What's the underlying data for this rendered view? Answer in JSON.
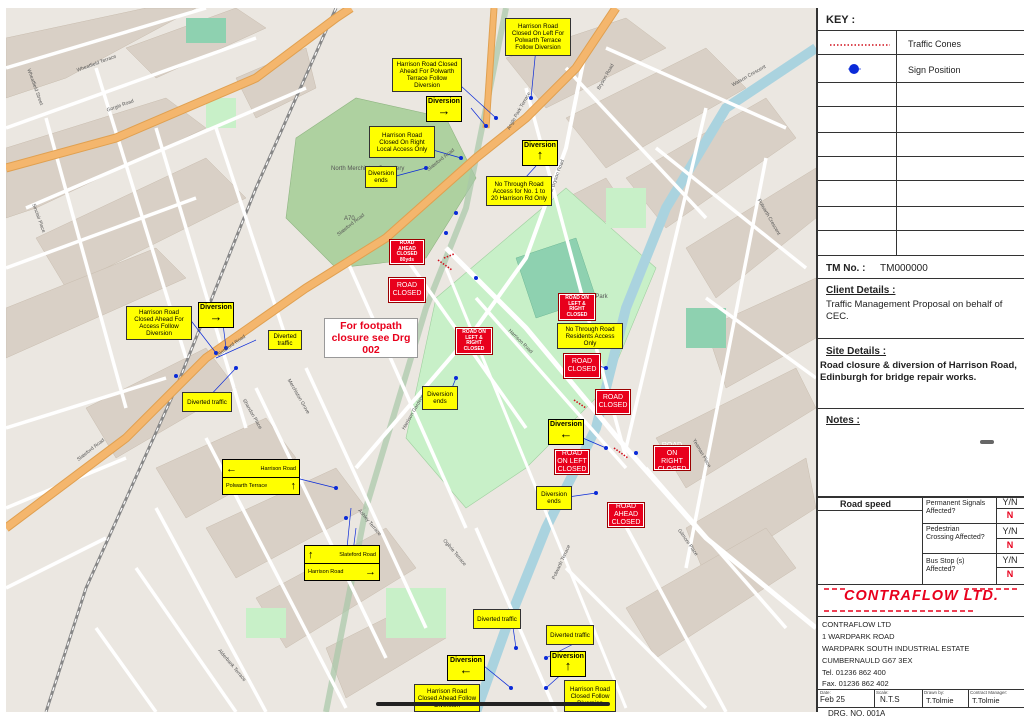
{
  "map_labels": {
    "gorgie_road": "Gorgie Road",
    "slateford_road_1": "Slateford Road",
    "slateford_road_2": "Slateford Road",
    "slateford_road_3": "Slateford Road",
    "slateford_road_4": "Slateford Road",
    "angle_park_terrace": "Angle Park Terrace",
    "west_bryson_road": "West Bryson Road",
    "harrison_road": "Harrison Road",
    "harrison_gardens": "Harrison Gardens",
    "shandon_place": "Shandon Place",
    "ashley_terrace": "Ashley Terrace",
    "ogilvie_terrace": "Ogilvie Terrace",
    "polwarth_terrace": "Polwarth Terrace",
    "harrison_park": "Harrison Park",
    "north_merchiston_cemetery": "North Merchiston Cemetery",
    "wheatfield_street": "Wheatfield Street",
    "wheatfield_terrace": "Wheatfield Terrace",
    "sinclair_place": "Sinclair Place",
    "alderbank_terrace": "Alderbank Terrace",
    "yeaman_place": "Yeaman Place",
    "bryson_road": "Bryson Road",
    "gilmore_place": "Gilmore Place",
    "merchiston_grove": "Merchiston Grove",
    "watson_crescent": "Watson Crescent",
    "polwarth_crescent": "Polwarth Crescent",
    "a70": "A70"
  },
  "signs": {
    "yellow": [
      {
        "text": "Harrison Road Closed On Left For Polwarth Terrace Follow Diversion"
      },
      {
        "text": "Harrison Road Closed Ahead For Polwarth Terrace Follow Diversion"
      },
      {
        "text": "Harrison Road Closed On Right Local Access Only"
      },
      {
        "text": "Diversion ends"
      },
      {
        "text": "No Through Road Access for No. 1 to 20 Harrison Rd Only"
      },
      {
        "text": "Harrison Road Closed Ahead For Access Follow Diversion"
      },
      {
        "text": "Diverted traffic"
      },
      {
        "text": "Diverted traffic"
      },
      {
        "text": "No Through Road Residents Access Only"
      },
      {
        "text": "Diversion ends"
      },
      {
        "text": "Diversion ends"
      },
      {
        "text": "Diverted traffic"
      },
      {
        "text": "Diverted traffic"
      },
      {
        "text": "Harrison Road Closed Ahead Follow Diversion"
      },
      {
        "text": "Harrison Road Closed Follow Diversion"
      }
    ],
    "red": [
      {
        "text": "ROAD AHEAD CLOSED 80yds"
      },
      {
        "text": "ROAD CLOSED"
      },
      {
        "text": "ROAD ON LEFT & RIGHT CLOSED"
      },
      {
        "text": "ROAD ON LEFT & RIGHT CLOSED"
      },
      {
        "text": "ROAD CLOSED"
      },
      {
        "text": "ROAD CLOSED"
      },
      {
        "text": "ROAD ON LEFT CLOSED"
      },
      {
        "text": "ROAD ON RIGHT CLOSED"
      },
      {
        "text": "ROAD AHEAD CLOSED"
      }
    ],
    "diversion": {
      "label": "Diversion",
      "arrow_right": "→",
      "arrow_left": "←",
      "arrow_up": "↑"
    },
    "twoway_1": {
      "top": "Harrison Road",
      "bottom": "Polwarth Terrace",
      "top_arrow": "←",
      "bottom_arrow": "↑"
    },
    "twoway_2": {
      "top": "Slateford Road",
      "bottom": "Harrison Road",
      "top_arrow": "↑",
      "bottom_arrow": "→"
    },
    "footpath_note": "For footpath closure see Drg 002"
  },
  "panel": {
    "key_title": "KEY :",
    "legend": [
      {
        "label": "Traffic Cones"
      },
      {
        "label": "Sign Position"
      }
    ],
    "tm_no_label": "TM No. :",
    "tm_no_value": "TM000000",
    "client_head": "Client Details :",
    "client_body": "Traffic Management Proposal on behalf of CEC.",
    "site_head": "Site Details :",
    "site_body": "Road closure & diversion of Harrison Road, Edinburgh for bridge repair works.",
    "notes_head": "Notes :",
    "road_speed": "Road speed",
    "questions": [
      {
        "label": "Permanent Signals Affected?",
        "yn": "Y/N",
        "answer": "N"
      },
      {
        "label": "Pedestrian Crossing Affected?",
        "yn": "Y/N",
        "answer": "N"
      },
      {
        "label": "Bus Stop (s) Affected?",
        "yn": "Y/N",
        "answer": "N"
      }
    ],
    "logo": "CONTRAFLOW LTD.",
    "address": [
      "CONTRAFLOW LTD",
      "1 WARDPARK ROAD",
      "WARDPARK SOUTH INDUSTRIAL ESTATE",
      "CUMBERNAULD  G67 3EX",
      "Tel.  01236 862 400",
      "Fax.  01236 862 402"
    ],
    "date_label": "Date:",
    "date_value": "Feb 25",
    "scale_label": "Scale:",
    "scale_value": "N.T.S",
    "drawn_label": "Drawn by:",
    "drawn_value": "T.Tolmie",
    "contract_label": "Contract Manager:",
    "contract_value": "T.Tolmie",
    "drg_no": "DRG. NO. 001A"
  },
  "colors": {
    "sign_yellow": "#ffff00",
    "sign_red": "#e8001c",
    "cone_red": "#d0101c",
    "sign_position_blue": "#0a2ad8",
    "road_orange": "#f4b66d",
    "park_green": "#c8f0c8",
    "river_blue": "#aad3df",
    "building_tan": "#d9cfc4",
    "residential": "#e0dfdf"
  }
}
